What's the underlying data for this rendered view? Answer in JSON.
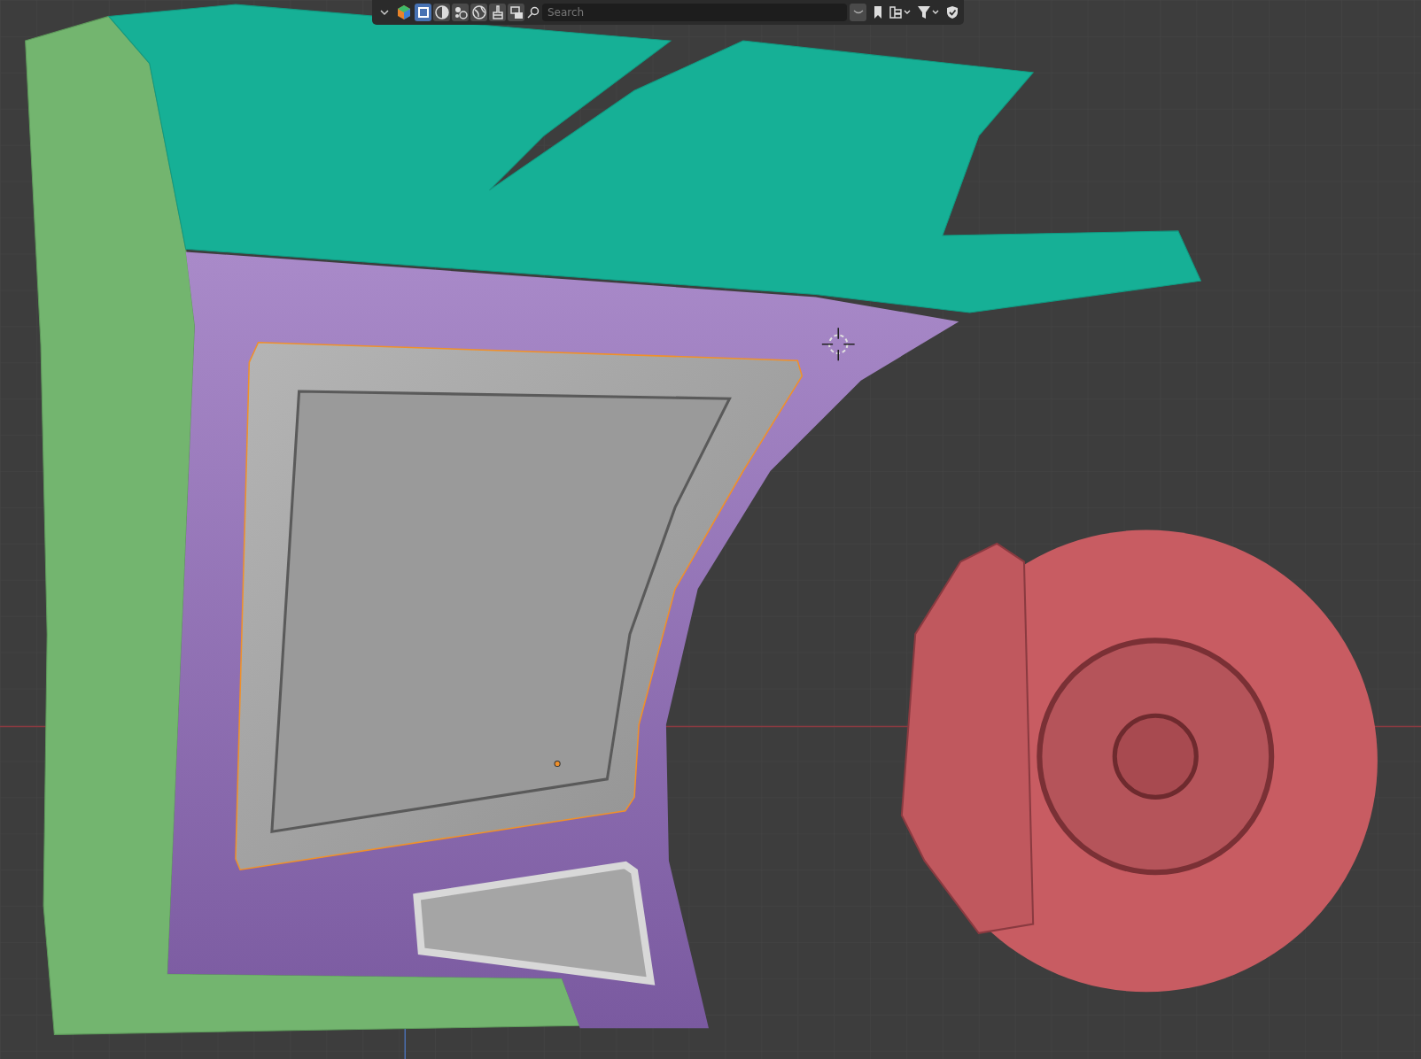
{
  "header": {
    "display_modes": [
      {
        "kind": "selectable",
        "selected": true
      },
      {
        "kind": "shading",
        "selected": false
      },
      {
        "kind": "particles",
        "selected": false
      },
      {
        "kind": "world",
        "selected": false
      },
      {
        "kind": "paint",
        "selected": false
      },
      {
        "kind": "copy",
        "selected": false
      }
    ],
    "search": {
      "placeholder": "Search"
    }
  }
}
